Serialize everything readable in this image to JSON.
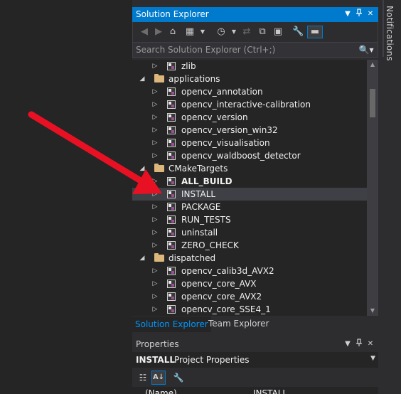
{
  "solution_explorer": {
    "title": "Solution Explorer",
    "search_placeholder": "Search Solution Explorer (Ctrl+;)",
    "tree": [
      {
        "type": "project",
        "label": "zlib",
        "level": 1
      },
      {
        "type": "folder",
        "label": "applications",
        "level": 0,
        "expanded": true
      },
      {
        "type": "project",
        "label": "opencv_annotation",
        "level": 1
      },
      {
        "type": "project",
        "label": "opencv_interactive-calibration",
        "level": 1
      },
      {
        "type": "project",
        "label": "opencv_version",
        "level": 1
      },
      {
        "type": "project",
        "label": "opencv_version_win32",
        "level": 1
      },
      {
        "type": "project",
        "label": "opencv_visualisation",
        "level": 1
      },
      {
        "type": "project",
        "label": "opencv_waldboost_detector",
        "level": 1
      },
      {
        "type": "folder",
        "label": "CMakeTargets",
        "level": 0,
        "expanded": true
      },
      {
        "type": "project",
        "label": "ALL_BUILD",
        "level": 1,
        "bold": true
      },
      {
        "type": "project",
        "label": "INSTALL",
        "level": 1,
        "selected": true
      },
      {
        "type": "project",
        "label": "PACKAGE",
        "level": 1
      },
      {
        "type": "project",
        "label": "RUN_TESTS",
        "level": 1
      },
      {
        "type": "project",
        "label": "uninstall",
        "level": 1
      },
      {
        "type": "project",
        "label": "ZERO_CHECK",
        "level": 1
      },
      {
        "type": "folder",
        "label": "dispatched",
        "level": 0,
        "expanded": true
      },
      {
        "type": "project",
        "label": "opencv_calib3d_AVX2",
        "level": 1
      },
      {
        "type": "project",
        "label": "opencv_core_AVX",
        "level": 1
      },
      {
        "type": "project",
        "label": "opencv_core_AVX2",
        "level": 1
      },
      {
        "type": "project",
        "label": "opencv_core_SSE4_1",
        "level": 1
      }
    ]
  },
  "bottom_tabs": [
    {
      "label": "Solution Explorer",
      "active": true
    },
    {
      "label": "Team Explorer",
      "active": false
    }
  ],
  "properties": {
    "title": "Properties",
    "object_name": "INSTALL",
    "object_type": "Project Properties",
    "row_key": "(Name)",
    "row_value": "INSTALL"
  },
  "notifications": {
    "label": "Notifications"
  },
  "colors": {
    "accent": "#007acc",
    "arrow": "#e81123",
    "selected_row": "#3f3f46"
  }
}
